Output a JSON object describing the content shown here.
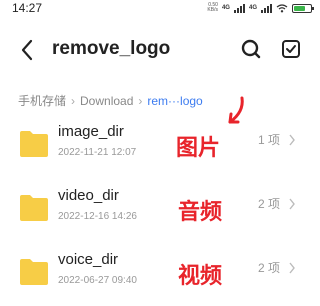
{
  "status_bar": {
    "time": "14:27",
    "net_speed_value": "0.50",
    "net_speed_unit": "KB/s",
    "network_tag": "4G",
    "network_tag_2": "4G",
    "battery_percent": 70,
    "accent_battery": "#3bb54a"
  },
  "header": {
    "title": "remove_logo",
    "back_icon": "back-arrow-icon",
    "search_icon": "search-icon",
    "select_icon": "checkbox-icon"
  },
  "breadcrumb": {
    "items": [
      "手机存储",
      "Download",
      "rem···logo"
    ]
  },
  "folders": [
    {
      "name": "image_dir",
      "date": "2022-11-21 12:07",
      "count": "1 项",
      "annotation": "图片"
    },
    {
      "name": "video_dir",
      "date": "2022-12-16 14:26",
      "count": "2 项",
      "annotation": "音频"
    },
    {
      "name": "voice_dir",
      "date": "2022-06-27 09:40",
      "count": "2 项",
      "annotation": "视频"
    }
  ],
  "colors": {
    "folder": "#f7cd46",
    "breadcrumb_active": "#3d7cf0",
    "annotation": "#e8242b"
  }
}
